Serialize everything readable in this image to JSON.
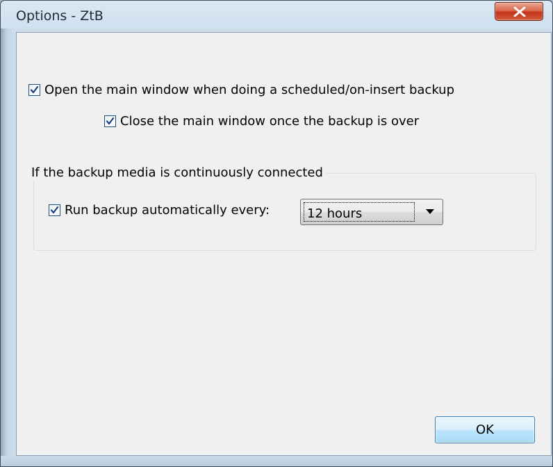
{
  "window": {
    "title": "Options - ZtB"
  },
  "options": {
    "open_main_window": {
      "label": "Open the main window when doing a scheduled/on-insert backup",
      "checked": true
    },
    "close_main_window": {
      "label": "Close the main window once the backup is over",
      "checked": true
    }
  },
  "group": {
    "legend": "If the backup media is continuously connected",
    "run_backup": {
      "label": "Run backup automatically every:",
      "checked": true
    },
    "interval_select": {
      "selected": "12 hours"
    }
  },
  "buttons": {
    "ok": "OK"
  },
  "icons": {
    "close": "close-icon",
    "check": "checkmark-icon",
    "dropdown": "chevron-down-icon"
  }
}
